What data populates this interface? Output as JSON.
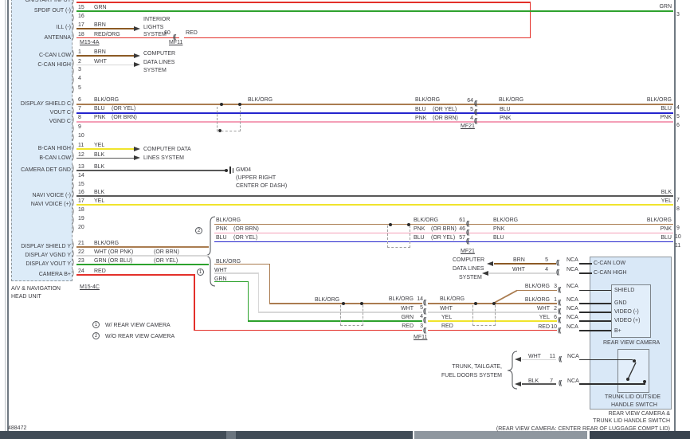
{
  "page": {
    "diagram_number": "488472"
  },
  "head_unit": {
    "name1": "A/V & NAVIGATION",
    "name2": "HEAD UNIT",
    "connector_top": "M15-4A",
    "connector_bottom": "M15-4C",
    "pins": {
      "onstart": {
        "label": "ON/START INPUT"
      },
      "spdif": {
        "label": "SPDIF OUT (-)",
        "num": "15",
        "color": "GRN"
      },
      "p16": {
        "num": "16"
      },
      "ill": {
        "label": "ILL (-)",
        "num": "17",
        "color": "BRN"
      },
      "antenna": {
        "label": "ANTENNA",
        "num": "18",
        "color": "RED/ORG"
      },
      "cclow": {
        "label": "C-CAN LOW",
        "num": "1",
        "color": "BRN"
      },
      "cchigh": {
        "label": "C-CAN HIGH",
        "num": "2",
        "color": "WHT"
      },
      "p3": {
        "num": "3"
      },
      "p4": {
        "num": "4"
      },
      "p5": {
        "num": "5"
      },
      "shieldc": {
        "label": "DISPLAY SHIELD C",
        "num": "6",
        "color": "BLK/ORG"
      },
      "voutc": {
        "label": "VOUT C",
        "num": "7",
        "color": "BLU",
        "alt": "(OR YEL)"
      },
      "vgndc": {
        "label": "VGND C",
        "num": "8",
        "color": "PNK",
        "alt": "(OR BRN)"
      },
      "p9": {
        "num": "9"
      },
      "p10": {
        "num": "10"
      },
      "bchigh": {
        "label": "B-CAN HIGH",
        "num": "11",
        "color": "YEL"
      },
      "bclow": {
        "label": "B-CAN LOW",
        "num": "12",
        "color": "BLK"
      },
      "camdet": {
        "label": "CAMERA DET GND",
        "num": "13",
        "color": "BLK"
      },
      "p14": {
        "num": "14"
      },
      "p15": {
        "num": "15"
      },
      "navim": {
        "label": "NAVI VOICE (-)",
        "num": "16",
        "color": "BLK"
      },
      "navip": {
        "label": "NAVI VOICE (+)",
        "num": "17",
        "color": "YEL"
      },
      "p18": {
        "num": "18"
      },
      "p19": {
        "num": "19"
      },
      "p20": {
        "num": "20"
      },
      "shieldy": {
        "label": "DISPLAY SHIELD Y",
        "num": "21",
        "color": "BLK/ORG"
      },
      "vgndy": {
        "label": "DISPLAY VGND Y",
        "num": "22",
        "color": "WHT (OR PNK)",
        "alt": "(OR BRN)"
      },
      "vouty": {
        "label": "DISPLAY VOUT Y",
        "num": "23",
        "color": "GRN (OR BLU)",
        "alt": "(OR YEL)"
      },
      "camb": {
        "label": "CAMERA B+",
        "num": "24",
        "color": "RED"
      }
    }
  },
  "systems": {
    "interior": [
      "INTERIOR",
      "LIGHTS",
      "SYSTEM"
    ],
    "computer": [
      "COMPUTER",
      "DATA LINES",
      "SYSTEM"
    ],
    "bcan": [
      "COMPUTER DATA",
      "LINES SYSTEM"
    ],
    "trunk": [
      "TRUNK, TAILGATE,",
      "FUEL DOORS SYSTEM"
    ]
  },
  "ground": {
    "id": "GM04",
    "loc1": "(UPPER RIGHT",
    "loc2": "CENTER OF DASH)"
  },
  "connectors": {
    "mf11": "MF11",
    "mf21": "MF21"
  },
  "antenna_junction": {
    "pin": "60",
    "color": "RED"
  },
  "display_c": {
    "pre": {
      "w1": "BLK/ORG",
      "w2": "BLU",
      "w2alt": "(OR YEL)",
      "w3": "PNK",
      "w3alt": "(OR BRN)"
    },
    "mid1": "BLK/ORG",
    "pins": [
      "64",
      "5",
      "4"
    ],
    "post": [
      "BLK/ORG",
      "BLU",
      "PNK"
    ],
    "right": [
      "BLK/ORG",
      "BLU",
      "PNK"
    ],
    "right_pins": [
      "4",
      "5",
      "6"
    ]
  },
  "right_edge": {
    "grn": "GRN",
    "grn_pin": "3",
    "blk": "BLK",
    "blk_pin": "7",
    "yel": "YEL",
    "yel_pin": "8"
  },
  "group2": {
    "left": {
      "w1": "BLK/ORG",
      "w2": "PNK",
      "w2alt": "(OR BRN)",
      "w3": "BLU",
      "w3alt": "(OR YEL)"
    },
    "pre": {
      "w1": "BLK/ORG",
      "w2": "PNK",
      "w2alt": "(OR BRN)",
      "w3": "BLU",
      "w3alt": "(OR YEL)"
    },
    "pins": [
      "61",
      "46",
      "57"
    ],
    "post": [
      "BLK/ORG",
      "PNK",
      "BLU"
    ],
    "right": [
      "BLK/ORG",
      "PNK",
      "BLU"
    ],
    "right_pins": [
      "9",
      "10",
      "11"
    ]
  },
  "group1": {
    "left": [
      "BLK/ORG",
      "WHT",
      "GRN"
    ],
    "mid": "BLK/ORG",
    "pre": [
      "BLK/ORG",
      "WHT",
      "GRN",
      "RED"
    ],
    "pins": [
      "14",
      "5",
      "4",
      "3"
    ],
    "post": [
      "BLK/ORG",
      "WHT",
      "YEL",
      "RED"
    ]
  },
  "camera": {
    "title": "REAR VIEW CAMERA",
    "nca": "NCA",
    "rows": [
      {
        "color": "BLK/ORG",
        "pin": "3",
        "label": "SHIELD"
      },
      {
        "color": "BLK/ORG",
        "pin": "1",
        "label": "GND"
      },
      {
        "color": "WHT",
        "pin": "2",
        "label": "VIDEO (-)"
      },
      {
        "color": "YEL",
        "pin": "6",
        "label": "VIDEO (+)"
      },
      {
        "color": "RED",
        "pin": "10",
        "label": "B+"
      }
    ],
    "ccan": [
      {
        "color": "BRN",
        "pin": "5",
        "label": "C-CAN LOW"
      },
      {
        "color": "WHT",
        "pin": "4",
        "label": "C-CAN HIGH"
      }
    ]
  },
  "switch": {
    "rows": [
      {
        "color": "WHT",
        "pin": "11"
      },
      {
        "color": "BLK",
        "pin": "7"
      }
    ],
    "name1": "TRUNK LID OUTSIDE",
    "name2": "HANDLE SWITCH"
  },
  "assembly": {
    "cap1": "REAR VIEW CAMERA &",
    "cap2": "TRUNK LID HANDLE SWITCH",
    "cap3": "(REAR VIEW CAMERA: CENTER REAR OF LUGGAGE COMPT LID)"
  },
  "notes": [
    {
      "sym": "1",
      "text": "W/ REAR VIEW CAMERA"
    },
    {
      "sym": "2",
      "text": "W/O REAR VIEW CAMERA"
    }
  ],
  "colors": {
    "red": "#e3302a",
    "grn": "#2da22d",
    "brn": "#8c5a25",
    "wht": "#d8d8d8",
    "blkorg": "#aa7c50",
    "blu": "#2525cd",
    "pnk": "#f49fb7",
    "yel": "#f0e42c",
    "blk": "#585858",
    "stub": "#2e2e2e",
    "box_fill": "#dcebf8"
  }
}
